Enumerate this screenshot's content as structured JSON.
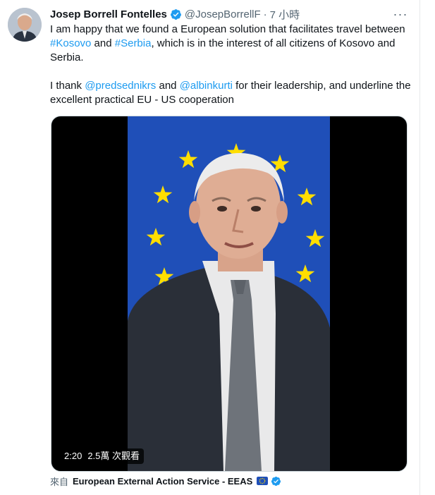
{
  "tweet": {
    "author_name": "Josep Borrell Fontelles",
    "handle": "@JosepBorrellF",
    "separator": "·",
    "time": "7 小時",
    "more_label": "···",
    "body": {
      "p1_text1": "I am happy that we found a European solution that facilitates travel between ",
      "p1_link1": "#Kosovo",
      "p1_text2": " and ",
      "p1_link2": "#Serbia",
      "p1_text3": ", which is in the interest of all citizens of Kosovo and Serbia.",
      "p2_text1": "I thank ",
      "p2_link1": "@predsednikrs",
      "p2_text2": " and ",
      "p2_link2": "@albinkurti",
      "p2_text3": " for their leadership, and underline the excellent practical EU - US cooperation"
    },
    "video": {
      "duration": "2:20",
      "views": "2.5萬 次觀看"
    },
    "source": {
      "prefix": "來自",
      "name": "European External Action Service - EEAS"
    }
  },
  "colors": {
    "link": "#1d9bf0",
    "verified": "#1d9bf0",
    "eu_blue": "#1f4fb8",
    "eu_star": "#ffde00"
  },
  "icons": [
    "verified-badge-icon",
    "more-options-icon",
    "eu-flag-icon"
  ]
}
